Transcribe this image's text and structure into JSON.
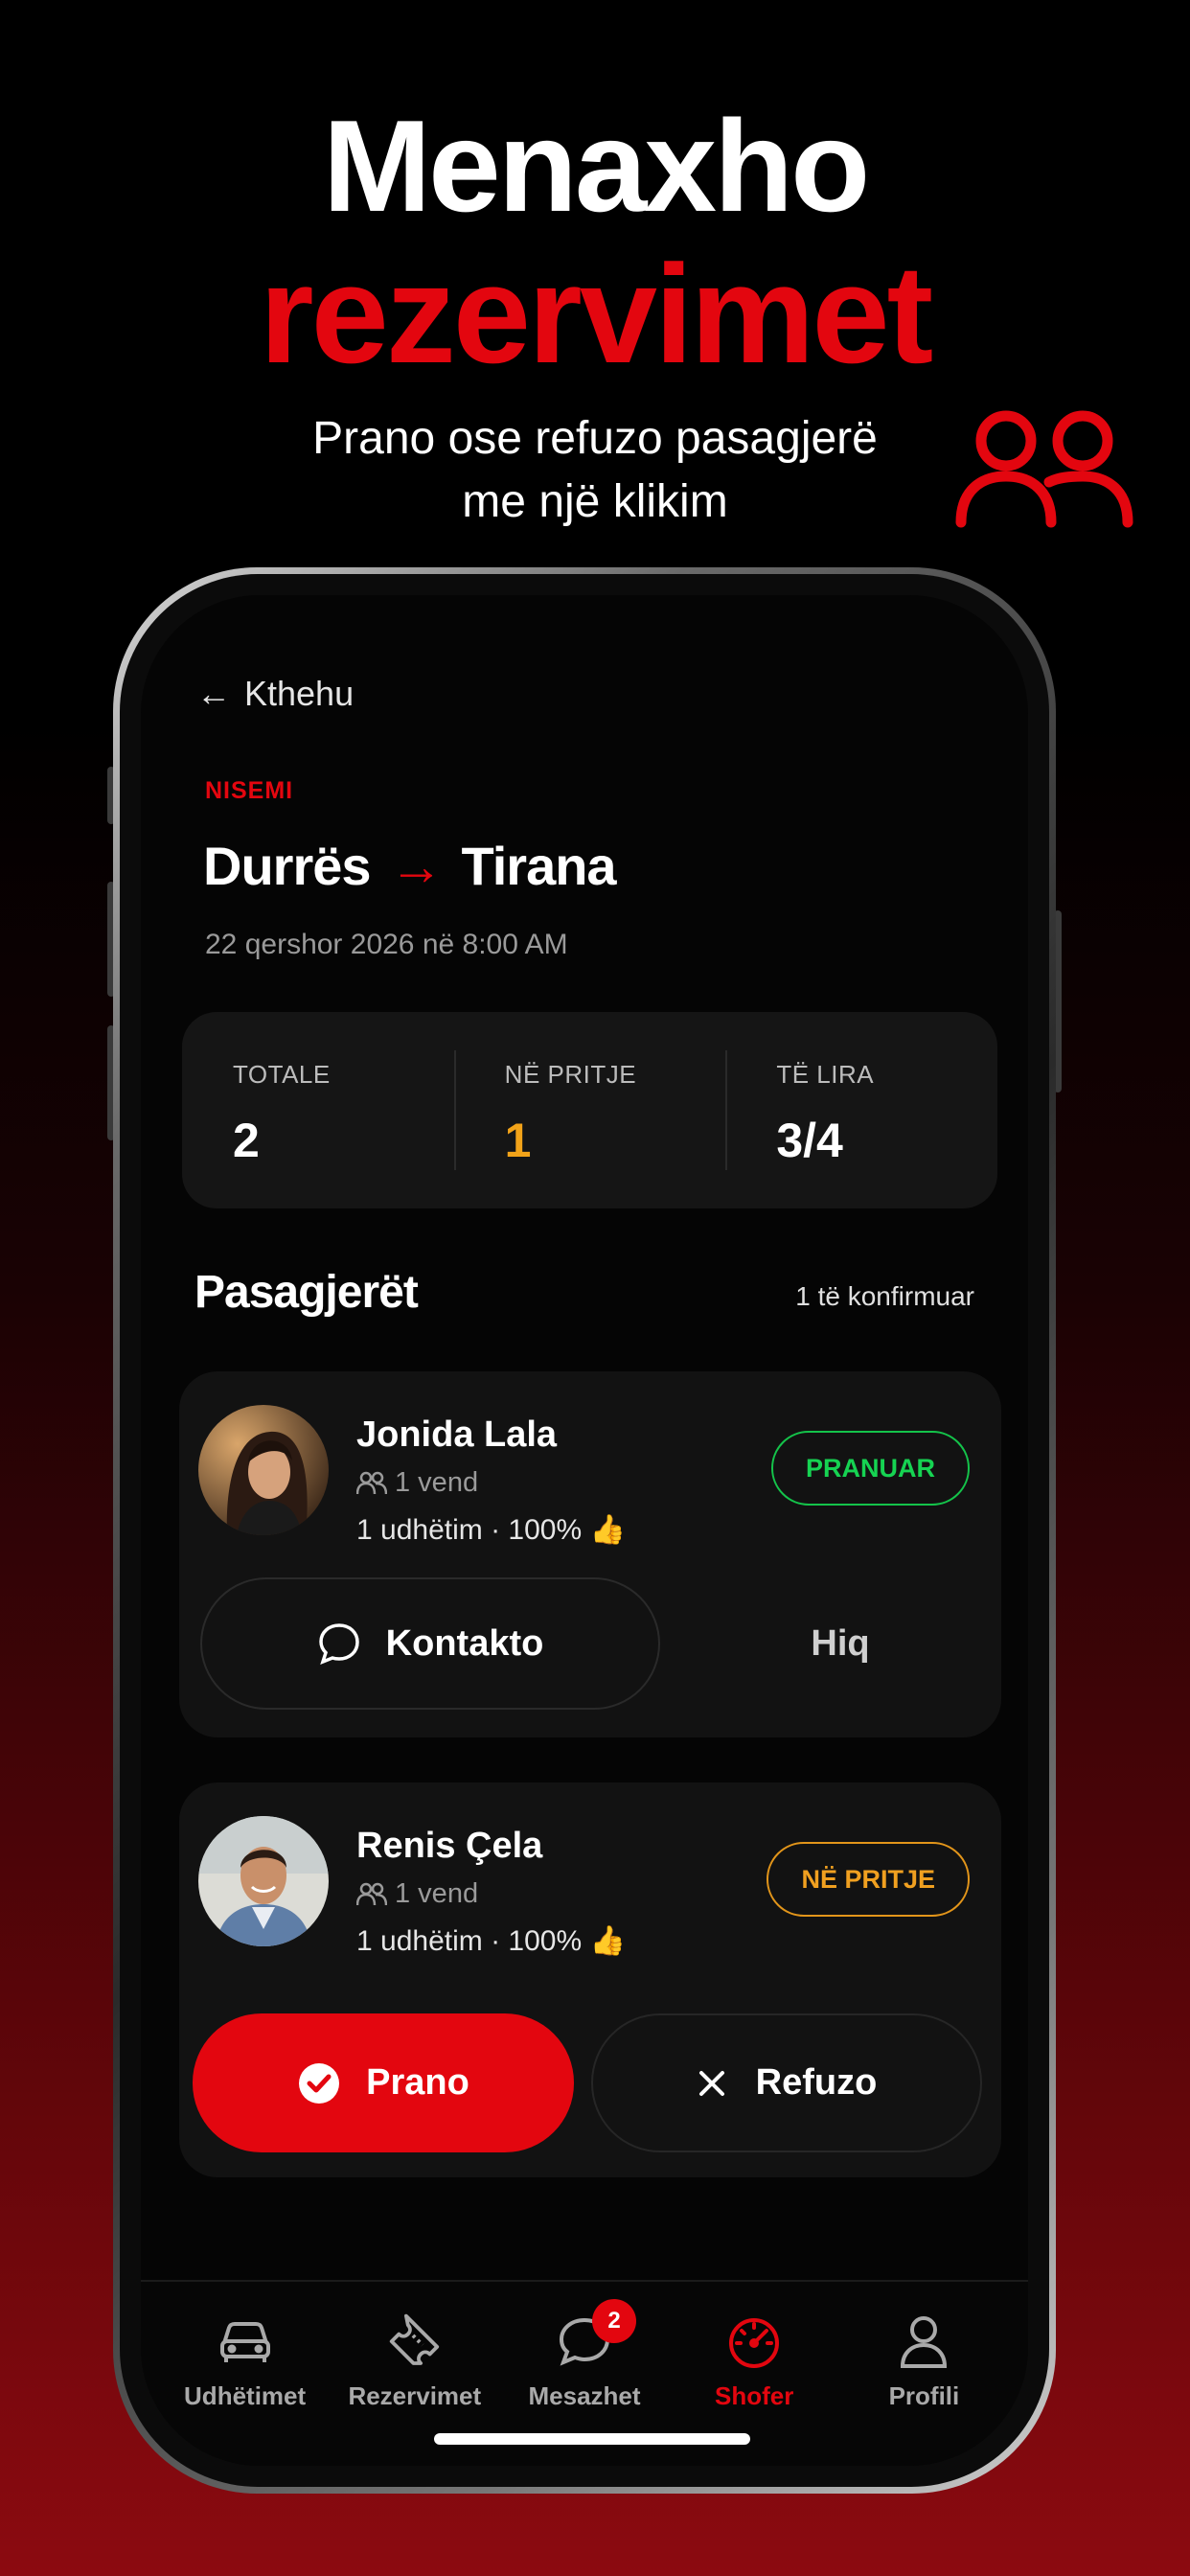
{
  "hero": {
    "title_line1": "Menaxho",
    "title_line2": "rezervimet",
    "subtitle_line1": "Prano ose refuzo pasagjerë",
    "subtitle_line2": "me një klikim"
  },
  "screen": {
    "back_label": "Kthehu",
    "section_label": "NISEMI",
    "route_from": "Durrës",
    "route_arrow": "→",
    "route_to": "Tirana",
    "date": "22 qershor 2026 në 8:00 AM",
    "stats": [
      {
        "label": "TOTALE",
        "value": "2"
      },
      {
        "label": "NË PRITJE",
        "value": "1"
      },
      {
        "label": "TË LIRA",
        "value": "3/4"
      }
    ],
    "passengers_title": "Pasagjerët",
    "confirmed_count": "1 të konfirmuar",
    "passengers": [
      {
        "name": "Jonida Lala",
        "seats": "1 vend",
        "trips": "1 udhëtim · 100% 👍",
        "status": "PRANUAR",
        "actions": {
          "contact": "Kontakto",
          "remove": "Hiq"
        }
      },
      {
        "name": "Renis Çela",
        "seats": "1 vend",
        "trips": "1 udhëtim · 100% 👍",
        "status": "NË PRITJE",
        "actions": {
          "accept": "Prano",
          "refuse": "Refuzo"
        }
      }
    ],
    "tabs": [
      {
        "label": "Udhëtimet",
        "icon": "car-icon"
      },
      {
        "label": "Rezervimet",
        "icon": "ticket-icon"
      },
      {
        "label": "Mesazhet",
        "icon": "chat-icon",
        "badge": "2"
      },
      {
        "label": "Shofer",
        "icon": "speedometer-icon",
        "active": true
      },
      {
        "label": "Profili",
        "icon": "person-icon"
      }
    ]
  },
  "colors": {
    "accent_red": "#e3060f",
    "pending_orange": "#f2a319",
    "accepted_green": "#16d352"
  }
}
